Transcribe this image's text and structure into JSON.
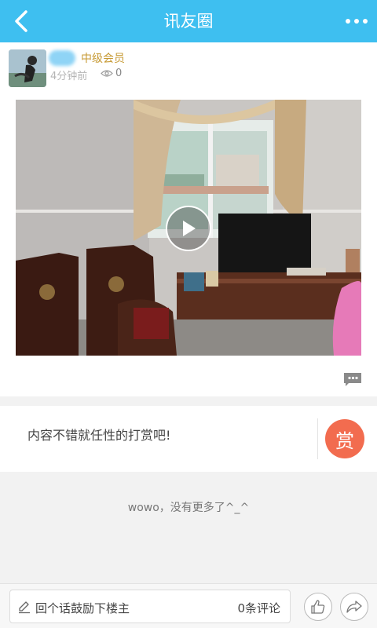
{
  "header": {
    "title": "讯友圈",
    "back_icon": "chevron-left-icon",
    "more_icon": "more-dots-icon"
  },
  "post": {
    "member_level": "中级会员",
    "time_ago": "4分钟前",
    "view_count": "0"
  },
  "reward": {
    "prompt": "内容不错就任性的打赏吧!",
    "button_label": "赏"
  },
  "feed": {
    "no_more_text": "wowo，没有更多了^_^"
  },
  "bottom_bar": {
    "reply_placeholder": "回个话鼓励下楼主",
    "comment_count_text": "0条评论"
  },
  "colors": {
    "header_bg": "#3ebff0",
    "reward_button": "#f26c4f",
    "member_level": "#c79a34"
  }
}
